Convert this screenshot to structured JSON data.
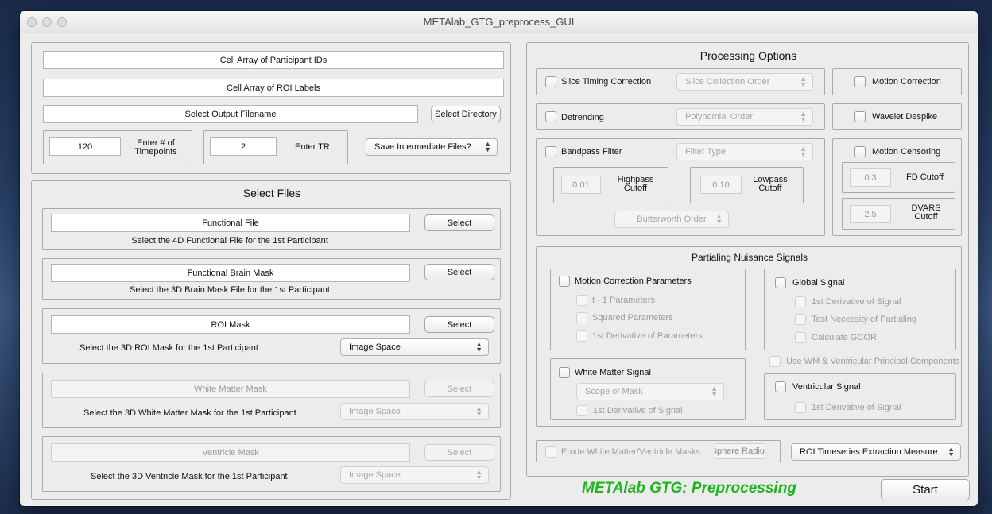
{
  "window": {
    "title": "METAlab_GTG_preprocess_GUI"
  },
  "top": {
    "participant_ids": "Cell Array of Participant IDs",
    "roi_labels": "Cell Array of ROI Labels",
    "output_filename": "Select Output Filename",
    "select_directory": "Select Directory",
    "timepoints_value": "120",
    "timepoints_label": "Enter # of Timepoints",
    "tr_value": "2",
    "tr_label": "Enter TR",
    "intermediate_files": "Save Intermediate Files?"
  },
  "select_files": {
    "title": "Select Files",
    "select_button": "Select",
    "image_space": "Image Space",
    "functional": {
      "field": "Functional File",
      "desc": "Select the 4D Functional File for the 1st Participant"
    },
    "brain_mask": {
      "field": "Functional Brain Mask",
      "desc": "Select the 3D Brain Mask File for the 1st Participant"
    },
    "roi_mask": {
      "field": "ROI Mask",
      "desc": "Select the 3D ROI Mask for the 1st Participant"
    },
    "wm_mask": {
      "field": "White Matter Mask",
      "desc": "Select the 3D White Matter Mask for the 1st Participant"
    },
    "vent_mask": {
      "field": "Ventricle Mask",
      "desc": "Select the 3D Ventricle Mask for the 1st Participant"
    }
  },
  "processing": {
    "title": "Processing Options",
    "slice_timing": "Slice Timing Correction",
    "slice_order": "Slice Collection Order",
    "motion_correction": "Motion Correction",
    "detrending": "Detrending",
    "poly_order": "Polynomial Order",
    "wavelet": "Wavelet Despike",
    "bandpass": "Bandpass Filter",
    "filter_type": "Filter Type",
    "highpass_value": "0.01",
    "highpass_label": "Highpass Cutoff",
    "lowpass_value": "0.10",
    "lowpass_label": "Lowpass Cutoff",
    "butterworth": "Butterworth Order",
    "motion_censoring": "Motion Censoring",
    "fd_value": "0.3",
    "fd_label": "FD Cutoff",
    "dvars_value": "2.5",
    "dvars_label": "DVARS Cutoff"
  },
  "nuisance": {
    "title": "Partialing Nuisance Signals",
    "mcp": "Motion Correction Parameters",
    "mcp_t1": "t - 1 Parameters",
    "mcp_sq": "Squared Parameters",
    "mcp_deriv": "1st Derivative of Parameters",
    "global": "Global Signal",
    "global_deriv": "1st Derivative of Signal",
    "global_test": "Test Necessity of Partialing",
    "global_gcor": "Calculate GCOR",
    "use_pca": "Use WM & Ventricular Principal Components",
    "wm": "White Matter Signal",
    "scope": "Scope of Mask",
    "wm_deriv": "1st Derivative of Signal",
    "vent": "Ventricular Signal",
    "vent_deriv": "1st Derivative of Signal"
  },
  "bottom": {
    "erode": "Erode White Matter/Ventricle Masks",
    "sphere": "Sphere Radius",
    "roi_measure": "ROI Timeseries Extraction Measure",
    "brand": "METAlab GTG: Preprocessing",
    "start": "Start"
  }
}
